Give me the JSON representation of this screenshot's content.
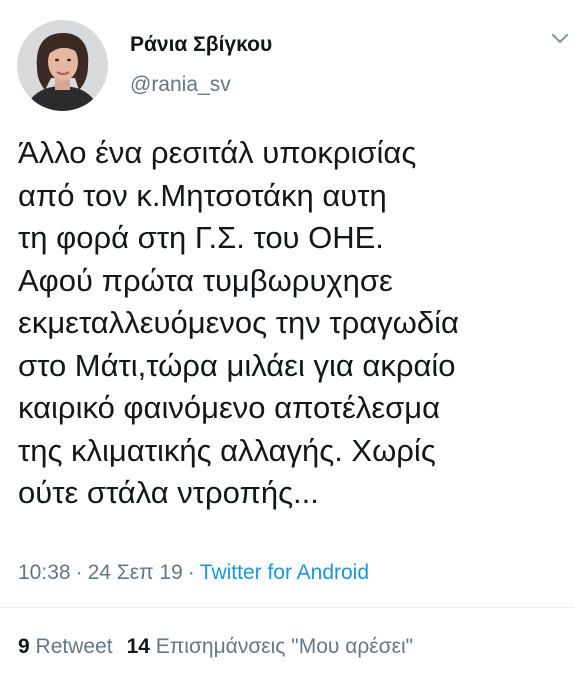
{
  "author": {
    "display_name": "Ράνια Σβίγκου",
    "handle": "@rania_sv"
  },
  "tweet": {
    "lines": [
      "Άλλο ένα ρεσιτάλ υποκρισίας",
      "από τον κ.Μητσοτάκη αυτη",
      "τη φορά στη Γ.Σ. του ΟΗΕ.",
      "Αφού πρώτα τυμβωρυχησε",
      "εκμεταλλευόμενος την τραγωδία",
      "στο Μάτι,τώρα μιλάει για ακραίο",
      "καιρικό φαινόμενο αποτέλεσμα",
      "της κλιματικής αλλαγής. Χωρίς",
      "ούτε στάλα ντροπής..."
    ],
    "time": "10:38",
    "date": "24 Σεπ 19",
    "separator": "·",
    "source": "Twitter for Android"
  },
  "stats": {
    "retweets_count": "9",
    "retweets_label": "Retweet",
    "likes_count": "14",
    "likes_label": "Επισημάνσεις \"Μου αρέσει\""
  },
  "icons": {
    "menu": "chevron-down-icon"
  },
  "colors": {
    "text": "#14171a",
    "secondary": "#657786",
    "link": "#1b95e0",
    "divider": "#e6ecf0"
  }
}
